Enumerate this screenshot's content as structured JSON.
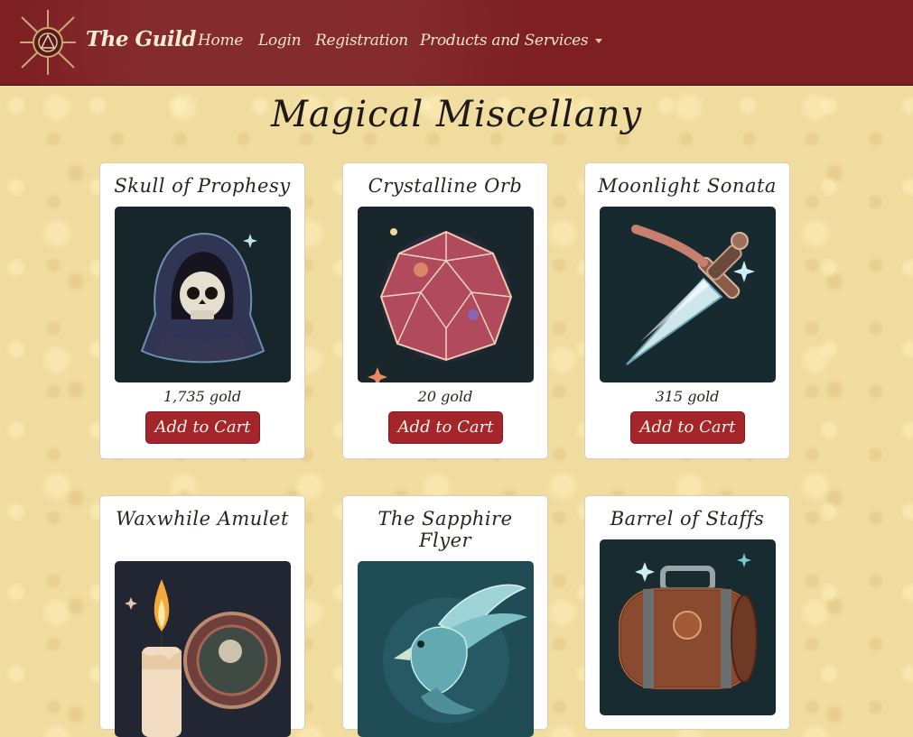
{
  "navbar": {
    "brand": "The Guild",
    "links": [
      "Home",
      "Login",
      "Registration"
    ],
    "dropdown_label": "Products and Services",
    "logo_icon": "guild-crest-icon"
  },
  "page": {
    "title": "Magical Miscellany"
  },
  "products": [
    {
      "name": "Skull of Prophesy",
      "price": "1,735 gold",
      "button": "Add to Cart",
      "image": "hooded-skull-illustration"
    },
    {
      "name": "Crystalline Orb",
      "price": "20 gold",
      "button": "Add to Cart",
      "image": "crystal-orb-illustration"
    },
    {
      "name": "Moonlight Sonata",
      "price": "315 gold",
      "button": "Add to Cart",
      "image": "dagger-illustration"
    },
    {
      "name": "Waxwhile Amulet",
      "image": "candle-amulet-illustration"
    },
    {
      "name": "The Sapphire Flyer",
      "image": "blue-bird-illustration"
    },
    {
      "name": "Barrel of Staffs",
      "image": "barrel-illustration"
    }
  ],
  "colors": {
    "navbar": "#7e2023",
    "button": "#a4252a",
    "parchment": "#f1dc9f"
  }
}
